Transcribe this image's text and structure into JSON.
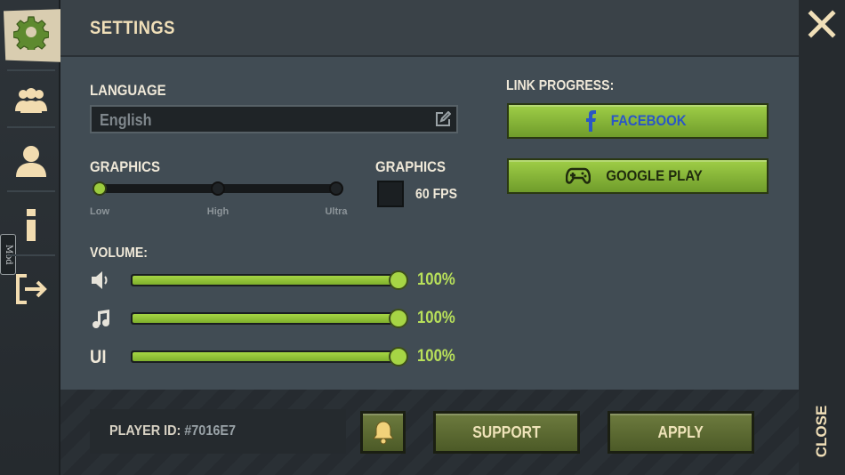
{
  "header": {
    "title": "SETTINGS"
  },
  "sidebar": {
    "items": [
      {
        "icon": "gear-icon",
        "active": true
      },
      {
        "icon": "friends-icon"
      },
      {
        "icon": "profile-icon"
      },
      {
        "icon": "info-icon"
      },
      {
        "icon": "logout-icon"
      }
    ],
    "mod_badge": "Mod"
  },
  "language": {
    "label": "LANGUAGE",
    "value": "English"
  },
  "graphics": {
    "label": "GRAPHICS",
    "levels": [
      "Low",
      "High",
      "Ultra"
    ],
    "selected_index": 0
  },
  "fps": {
    "label": "GRAPHICS",
    "option": "60 FPS",
    "checked": false
  },
  "volume": {
    "label": "VOLUME:",
    "channels": [
      {
        "icon": "speaker-icon",
        "label": "",
        "value": 100,
        "display": "100%"
      },
      {
        "icon": "music-note-icon",
        "label": "",
        "value": 100,
        "display": "100%"
      },
      {
        "icon": "",
        "label": "UI",
        "value": 100,
        "display": "100%"
      }
    ]
  },
  "link_progress": {
    "label": "LINK PROGRESS:",
    "facebook": "FACEBOOK",
    "google_play": "GOOGLE PLAY"
  },
  "player": {
    "label": "PLAYER ID:",
    "id": "#7016E7"
  },
  "buttons": {
    "support": "SUPPORT",
    "apply": "APPLY",
    "close": "CLOSE"
  },
  "colors": {
    "accent_green": "#9ccc3e",
    "title_cream": "#f0dfb8",
    "facebook_blue": "#2a56c6"
  }
}
